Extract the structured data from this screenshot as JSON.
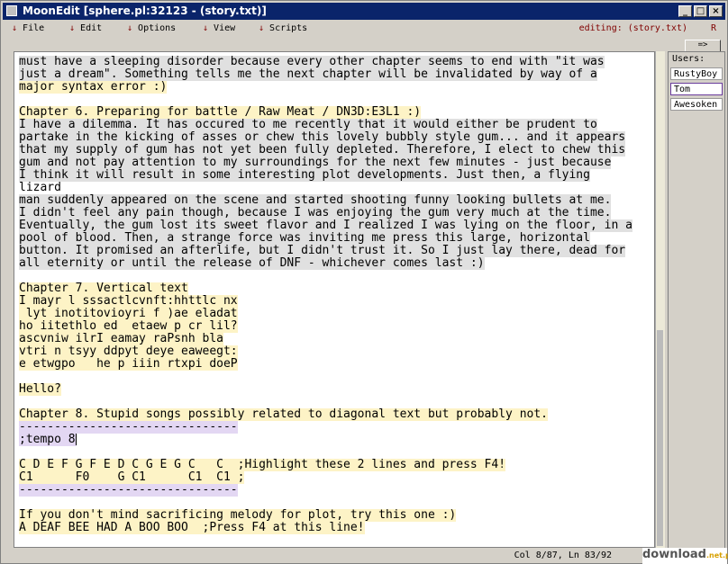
{
  "window": {
    "title": "MoonEdit [sphere.pl:32123 - (story.txt)]"
  },
  "menu": {
    "items": [
      "File",
      "Edit",
      "Options",
      "View",
      "Scripts"
    ],
    "status": "editing: (story.txt)",
    "right": "R"
  },
  "users": {
    "toggle_label": "=>",
    "label": "Users:",
    "list": [
      "RustyBoy",
      "Tom",
      "Awesoken"
    ]
  },
  "editor": {
    "lines": [
      "must have a sleeping disorder because every other chapter seems to end with \"it was",
      "just a dream\". Something tells me the next chapter will be invalidated by way of a",
      "major syntax error :)",
      "",
      "Chapter 6. Preparing for battle / Raw Meat / DN3D:E3L1 :)",
      "I have a dilemma. It has occured to me recently that it would either be prudent to",
      "partake in the kicking of asses or chew this lovely bubbly style gum... and it appears",
      "that my supply of gum has not yet been fully depleted. Therefore, I elect to chew this",
      "gum and not pay attention to my surroundings for the next few minutes - just because",
      "I think it will result in some interesting plot developments. Just then, a flying",
      "lizard",
      "man suddenly appeared on the scene and started shooting funny looking bullets at me.",
      "I didn't feel any pain though, because I was enjoying the gum very much at the time.",
      "Eventually, the gum lost its sweet flavor and I realized I was lying on the floor, in a",
      "pool of blood. Then, a strange force was inviting me press this large, horizontal",
      "button. It promised an afterlife, but I didn't trust it. So I just lay there, dead for",
      "all eternity or until the release of DNF - whichever comes last :)",
      "",
      "Chapter 7. Vertical text",
      "I mayr l sssactlcvnft:hhttlc nx",
      " lyt inotitovioyri f )ae eladat",
      "ho iitethlo ed  etaew p cr lil?",
      "ascvniw ilrI eamay raPsnh bla",
      "vtri n tsyy ddpyt deye eaweegt:",
      "e etwgpo   he p iiin rtxpi doeP",
      "",
      "Hello?",
      "",
      "Chapter 8. Stupid songs possibly related to diagonal text but probably not.",
      "-------------------------------",
      ";tempo 8",
      "",
      "C D E F G F E D C G E G C   C  ;Highlight these 2 lines and press F4!",
      "C1      F0    G C1      C1  C1 ;",
      "-------------------------------",
      "",
      "If you don't mind sacrificing melody for plot, try this one :)",
      "A DEAF BEE HAD A BOO BOO  ;Press F4 at this line!"
    ]
  },
  "statusbar": {
    "position": "Col 8/87, Ln 83/92"
  },
  "brand": {
    "text": "download",
    "suffix": ".net.pl"
  }
}
